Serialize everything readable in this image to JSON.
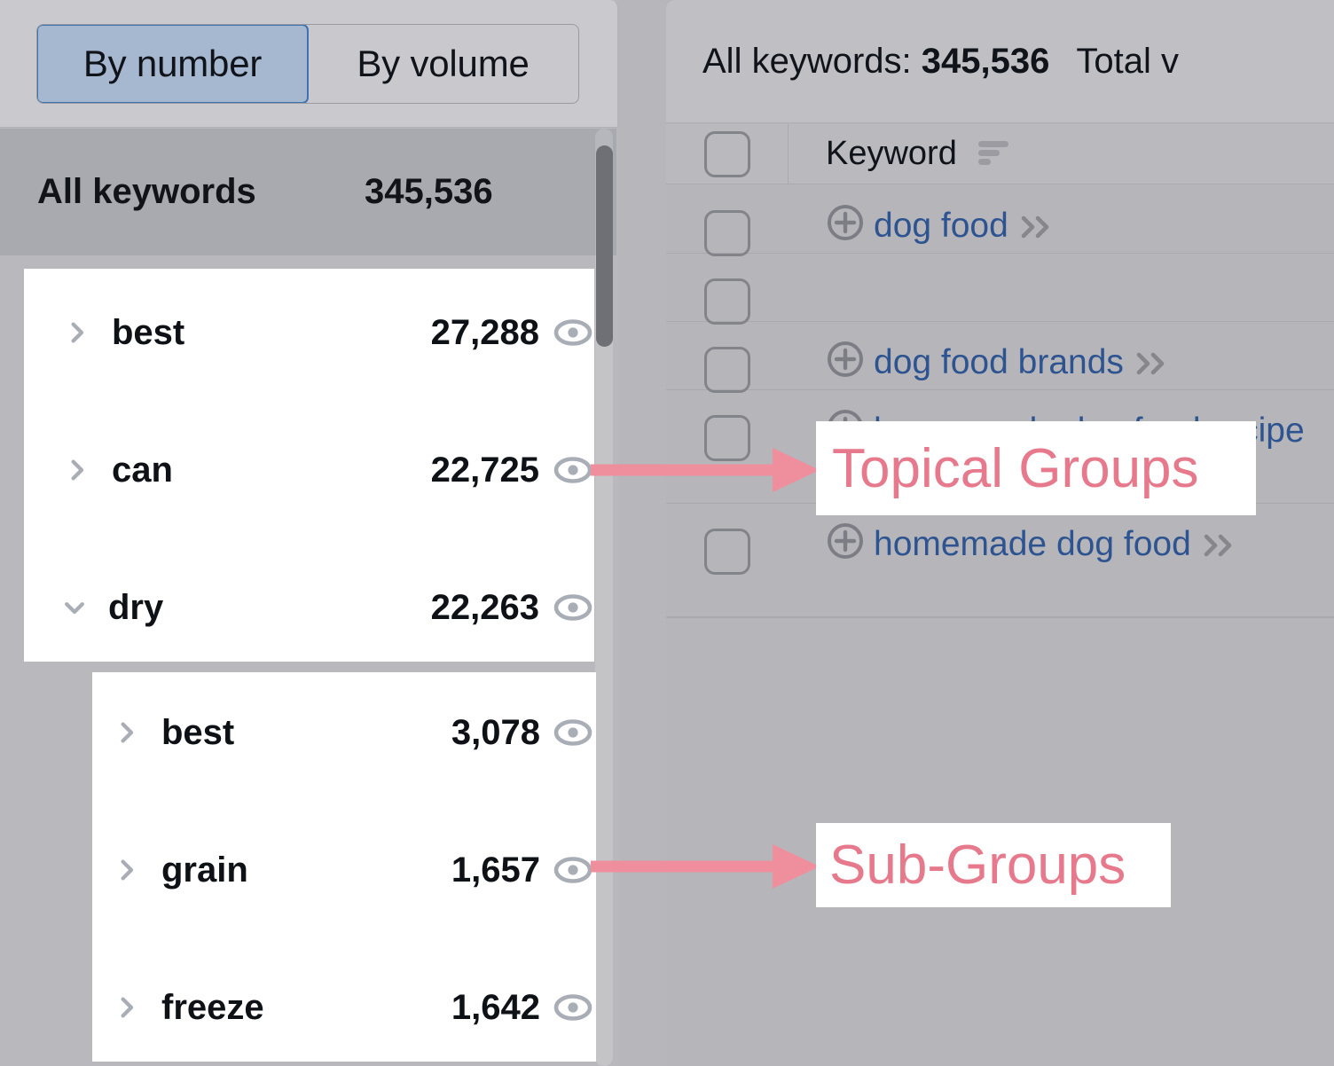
{
  "left_panel": {
    "toggle": {
      "options": [
        {
          "label": "By number",
          "selected": true
        },
        {
          "label": "By volume",
          "selected": false
        }
      ],
      "active_color": "#a6b8cf",
      "active_border": "#3f72b0"
    },
    "all_keywords_row": {
      "label": "All keywords",
      "count": "345,536",
      "selected": true,
      "selected_bg": "#a9aab0"
    },
    "topical_groups": [
      {
        "name": "best",
        "count": "27,288",
        "expanded": false,
        "chevron": "chevron-right-icon",
        "eye": "eye-icon"
      },
      {
        "name": "can",
        "count": "22,725",
        "expanded": false,
        "chevron": "chevron-right-icon",
        "eye": "eye-icon"
      },
      {
        "name": "dry",
        "count": "22,263",
        "expanded": true,
        "chevron": "chevron-down-icon",
        "eye": "eye-icon"
      }
    ],
    "sub_groups": [
      {
        "name": "best",
        "count": "3,078",
        "expanded": false,
        "chevron": "chevron-right-icon",
        "eye": "eye-icon"
      },
      {
        "name": "grain",
        "count": "1,657",
        "expanded": false,
        "chevron": "chevron-right-icon",
        "eye": "eye-icon"
      },
      {
        "name": "freeze",
        "count": "1,642",
        "expanded": false,
        "chevron": "chevron-right-icon",
        "eye": "eye-icon"
      }
    ],
    "scrollbar": {
      "name": "vertical-scrollbar",
      "thumb_color": "#6f7076"
    }
  },
  "right_panel": {
    "header": {
      "all_keywords_label": "All keywords:",
      "all_keywords_count": "345,536",
      "total_label_truncated": "Total v"
    },
    "table": {
      "columns": {
        "select_all": "select-all-checkbox",
        "keyword": "Keyword",
        "sort_icon": "sort-icon"
      },
      "rows": [
        {
          "keyword": "dog food",
          "add_icon": "plus-circle-icon",
          "expand_icon": "double-chevron-right-icon",
          "checked": false
        },
        {
          "keyword": "",
          "add_icon": "",
          "expand_icon": "",
          "checked": false
        },
        {
          "keyword": "dog food brands",
          "add_icon": "plus-circle-icon",
          "expand_icon": "double-chevron-right-icon",
          "checked": false
        },
        {
          "keyword": "home made dog food recipe",
          "add_icon": "plus-circle-icon",
          "expand_icon": "double-chevron-right-icon",
          "checked": false
        },
        {
          "keyword": "homemade dog food",
          "add_icon": "plus-circle-icon",
          "expand_icon": "double-chevron-right-icon",
          "checked": false
        }
      ]
    },
    "keyword_link_color": "#2d5490"
  },
  "annotations": {
    "accent_color": "#ef8e9d",
    "text_color": "#e6798b",
    "callouts": [
      {
        "text": "Topical Groups",
        "arrow": "arrow-right-topical"
      },
      {
        "text": "Sub-Groups",
        "arrow": "arrow-right-subgroups"
      }
    ]
  }
}
